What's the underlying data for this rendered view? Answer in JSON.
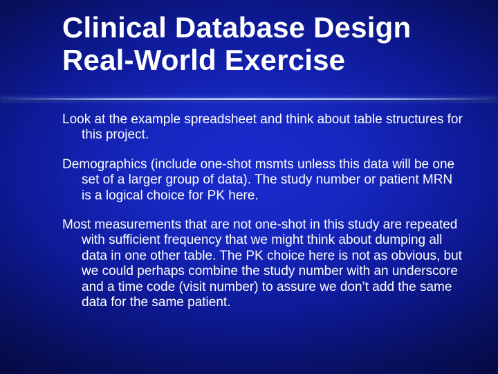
{
  "title_line1": "Clinical Database Design",
  "title_line2": "Real-World Exercise",
  "paragraphs": {
    "p1": "Look at the example spreadsheet and think about table structures for this project.",
    "p2": "Demographics (include one-shot msmts unless this data will be one set of a larger group of data).  The study number or patient MRN is a logical choice for PK here.",
    "p3": "Most measurements that are not one-shot in this study are repeated with sufficient frequency that we might think about dumping all data in one other table.  The PK choice here is not as obvious, but we could perhaps combine the study number with an underscore and a time code (visit number) to assure we don’t add the same data for the same patient."
  }
}
